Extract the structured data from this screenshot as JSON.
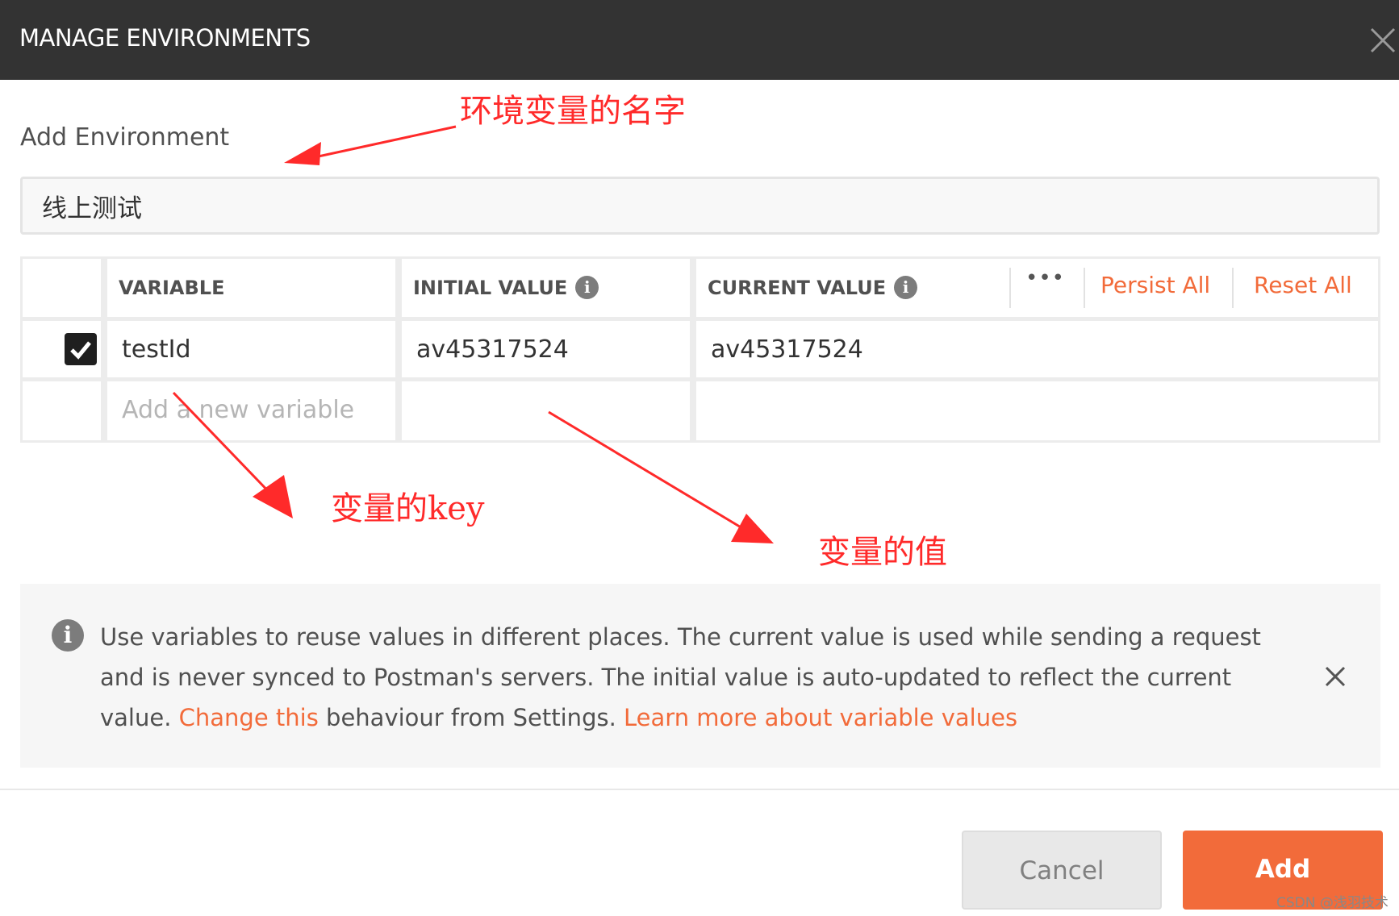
{
  "dialog": {
    "title": "MANAGE ENVIRONMENTS"
  },
  "form": {
    "section_label": "Add Environment",
    "environment_name": "线上测试"
  },
  "table": {
    "headers": {
      "variable": "VARIABLE",
      "initial_value": "INITIAL VALUE",
      "current_value": "CURRENT VALUE",
      "more": "•••",
      "persist_all": "Persist All",
      "reset_all": "Reset All"
    },
    "rows": [
      {
        "checked": true,
        "variable": "testId",
        "initial_value": "av45317524",
        "current_value": "av45317524"
      }
    ],
    "new_row_placeholder": "Add a new variable"
  },
  "info_banner": {
    "icon": "info-icon",
    "text_part1": "Use variables to reuse values in different places. The current value is used while sending a request and is never synced to Postman's servers. The initial value is auto-updated to reflect the current value.",
    "change_link": "Change this",
    "text_part2": "behaviour from Settings.",
    "learn_link": "Learn more about variable values"
  },
  "footer": {
    "cancel_label": "Cancel",
    "add_label": "Add"
  },
  "annotations": {
    "env_name": "环境变量的名字",
    "var_key": "变量的key",
    "var_value": "变量的值"
  },
  "watermark": "CSDN @浅羽技术",
  "colors": {
    "header_bg": "#333333",
    "accent_orange": "#f26b3a",
    "annotation_red": "#ff2a2a"
  }
}
